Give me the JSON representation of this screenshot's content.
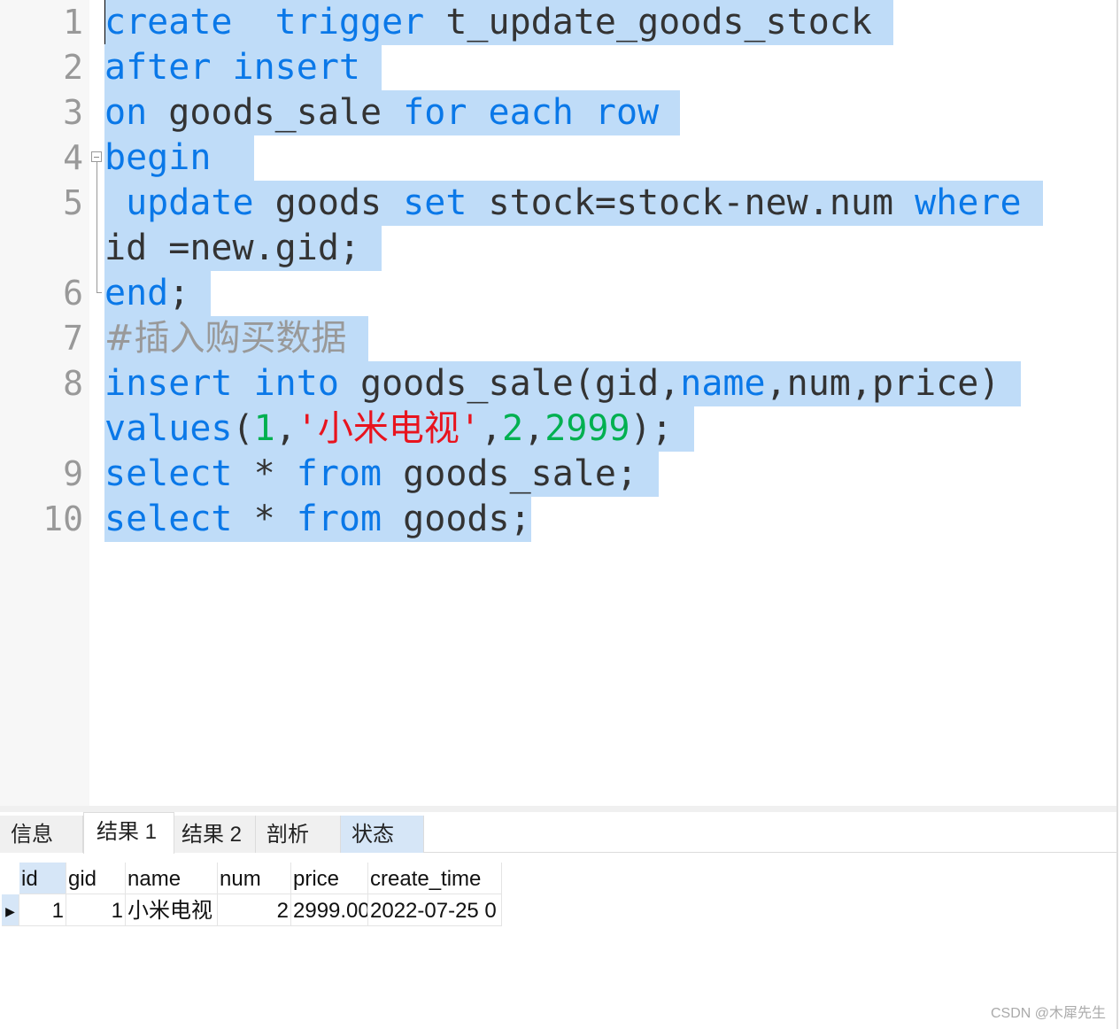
{
  "editor": {
    "lines": [
      {
        "num": "1",
        "tokens": [
          [
            "k",
            "create"
          ],
          [
            "",
            "  "
          ],
          [
            "k",
            "trigger"
          ],
          [
            "",
            " t_update_goods_stock"
          ]
        ]
      },
      {
        "num": "2",
        "tokens": [
          [
            "k",
            "after"
          ],
          [
            "",
            " "
          ],
          [
            "k",
            "insert"
          ]
        ]
      },
      {
        "num": "3",
        "tokens": [
          [
            "k",
            "on"
          ],
          [
            "",
            " goods_sale "
          ],
          [
            "k",
            "for"
          ],
          [
            "",
            " "
          ],
          [
            "k",
            "each"
          ],
          [
            "",
            " "
          ],
          [
            "k",
            "row"
          ]
        ]
      },
      {
        "num": "4",
        "tokens": [
          [
            "k",
            "begin"
          ],
          [
            "",
            " "
          ]
        ]
      },
      {
        "num": "5",
        "tokens": [
          [
            "",
            " "
          ],
          [
            "k",
            "update"
          ],
          [
            "",
            " goods "
          ],
          [
            "k",
            "set"
          ],
          [
            "",
            " stock=stock-new.num "
          ],
          [
            "k",
            "where"
          ]
        ]
      },
      {
        "num": "",
        "tokens": [
          [
            "",
            "id =new.gid;"
          ]
        ]
      },
      {
        "num": "6",
        "tokens": [
          [
            "k",
            "end"
          ],
          [
            "",
            ";"
          ]
        ]
      },
      {
        "num": "7",
        "tokens": [
          [
            "c",
            "#插入购买数据"
          ]
        ]
      },
      {
        "num": "8",
        "tokens": [
          [
            "k",
            "insert"
          ],
          [
            "",
            " "
          ],
          [
            "k",
            "into"
          ],
          [
            "",
            " goods_sale(gid,"
          ],
          [
            "k",
            "name"
          ],
          [
            "",
            ",num,price)"
          ]
        ]
      },
      {
        "num": "",
        "tokens": [
          [
            "k",
            "values"
          ],
          [
            "",
            "("
          ],
          [
            "n",
            "1"
          ],
          [
            "",
            ","
          ],
          [
            "s",
            "'小米电视'"
          ],
          [
            "",
            ","
          ],
          [
            "n",
            "2"
          ],
          [
            "",
            ","
          ],
          [
            "n",
            "2999"
          ],
          [
            "",
            ");"
          ]
        ]
      },
      {
        "num": "9",
        "tokens": [
          [
            "k",
            "select"
          ],
          [
            "",
            " * "
          ],
          [
            "k",
            "from"
          ],
          [
            "",
            " goods_sale;"
          ]
        ]
      },
      {
        "num": "10",
        "tokens": [
          [
            "k",
            "select"
          ],
          [
            "",
            " * "
          ],
          [
            "k",
            "from"
          ],
          [
            "",
            " goods;"
          ]
        ]
      }
    ]
  },
  "tabs": [
    "信息",
    "结果 1",
    "结果 2",
    "剖析",
    "状态"
  ],
  "active_tab": "结果 1",
  "grid": {
    "columns": [
      "id",
      "gid",
      "name",
      "num",
      "price",
      "create_time"
    ],
    "rows": [
      [
        "1",
        "1",
        "小米电视",
        "2",
        "2999.00",
        "2022-07-25 0"
      ]
    ]
  },
  "watermark": "CSDN @木犀先生",
  "colors": {
    "keyword": "#0a78e8",
    "number": "#00b050",
    "string": "#e8141e",
    "comment": "#999999",
    "selection": "#bfdcf8"
  }
}
